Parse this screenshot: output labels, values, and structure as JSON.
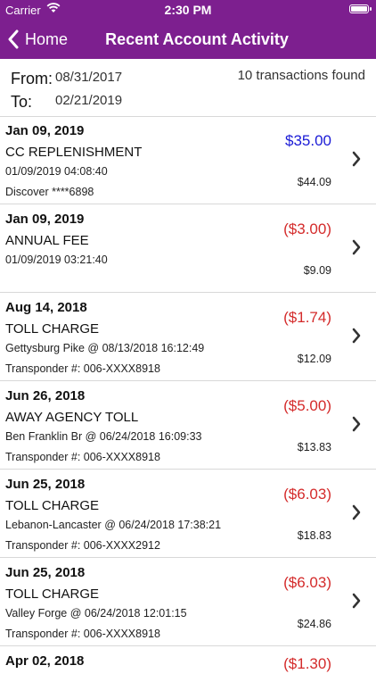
{
  "status_bar": {
    "carrier": "Carrier",
    "time": "2:30 PM"
  },
  "nav": {
    "back_label": "Home",
    "title": "Recent Account Activity"
  },
  "range": {
    "from_label": "From:",
    "from_value": "08/31/2017",
    "to_label": "To:",
    "to_value": "02/21/2019",
    "found_text": "10 transactions found"
  },
  "transactions": [
    {
      "date": "Jan 09, 2019",
      "description": "CC REPLENISHMENT",
      "detail": "01/09/2019 04:08:40",
      "extra": "Discover ****6898",
      "amount": "$35.00",
      "balance": "$44.09"
    },
    {
      "date": "Jan 09, 2019",
      "description": "ANNUAL FEE",
      "detail": "01/09/2019 03:21:40",
      "extra": "",
      "amount": "($3.00)",
      "balance": "$9.09"
    },
    {
      "date": "Aug 14, 2018",
      "description": "TOLL CHARGE",
      "detail": "Gettysburg Pike @ 08/13/2018 16:12:49",
      "extra": "Transponder #: 006-XXXX8918",
      "amount": "($1.74)",
      "balance": "$12.09"
    },
    {
      "date": "Jun 26, 2018",
      "description": "AWAY AGENCY TOLL",
      "detail": "Ben Franklin Br @ 06/24/2018 16:09:33",
      "extra": "Transponder #: 006-XXXX8918",
      "amount": "($5.00)",
      "balance": "$13.83"
    },
    {
      "date": "Jun 25, 2018",
      "description": "TOLL CHARGE",
      "detail": "Lebanon-Lancaster @ 06/24/2018 17:38:21",
      "extra": "Transponder #: 006-XXXX2912",
      "amount": "($6.03)",
      "balance": "$18.83"
    },
    {
      "date": "Jun 25, 2018",
      "description": "TOLL CHARGE",
      "detail": "Valley Forge @ 06/24/2018 12:01:15",
      "extra": "Transponder #: 006-XXXX8918",
      "amount": "($6.03)",
      "balance": "$24.86"
    },
    {
      "date": "Apr 02, 2018",
      "description": "",
      "detail": "",
      "extra": "",
      "amount": "($1.30)",
      "balance": ""
    }
  ],
  "colors": {
    "header": "#7d1f8f",
    "credit": "#1a1ad6",
    "debit": "#d42b2b"
  }
}
